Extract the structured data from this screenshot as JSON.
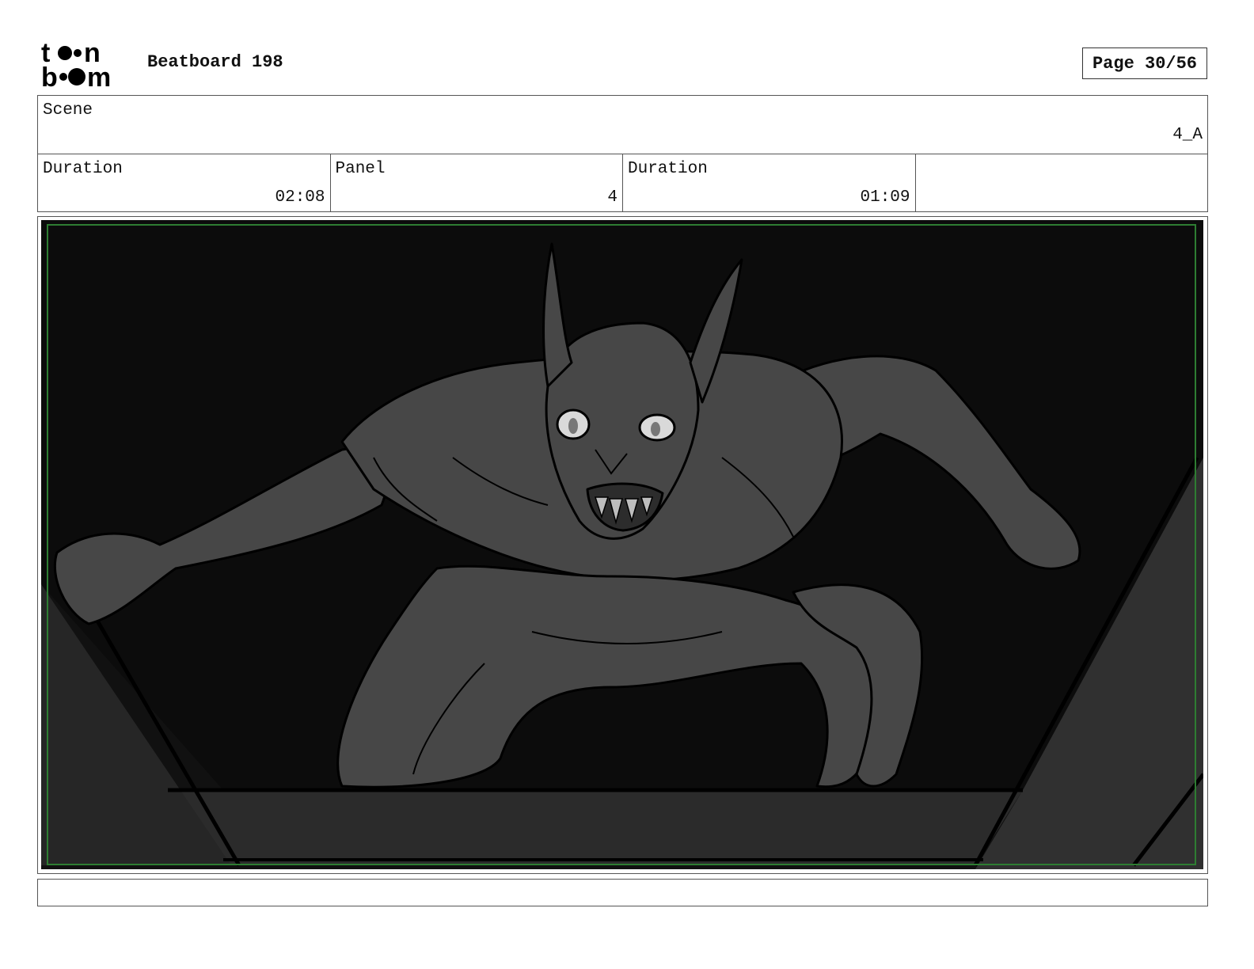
{
  "header": {
    "logo_text": "toon boom",
    "title": "Beatboard 198",
    "page_label": "Page 30/56"
  },
  "scene": {
    "label": "Scene",
    "value": "4_A"
  },
  "cells": [
    {
      "label": "Duration",
      "value": "02:08"
    },
    {
      "label": "Panel",
      "value": "4"
    },
    {
      "label": "Duration",
      "value": "01:09"
    },
    {
      "label": "",
      "value": ""
    }
  ],
  "panel": {
    "description": "",
    "safe_frame_color": "#2e7d32"
  },
  "notes": {
    "text": ""
  }
}
